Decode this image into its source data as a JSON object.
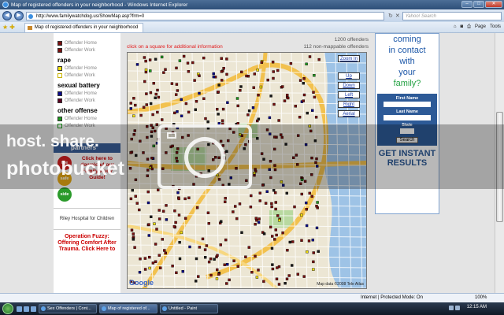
{
  "window": {
    "title": "Map of registered offenders in your neighborhood - Windows Internet Explorer",
    "url": "http://www.familywatchdog.us/ShowMap.asp?frm=0",
    "search_placeholder": "Yahoo! Search",
    "tab_label": "Map of registered offenders in your neighborhood",
    "cmd": {
      "page": "Page",
      "tools": "Tools"
    }
  },
  "legend": {
    "offender_home": "Offender Home",
    "offender_work": "Offender Work",
    "categories": [
      {
        "name": "",
        "home_color": "#7a0f0f",
        "work_color": "#7a0f0f"
      },
      {
        "name": "rape",
        "home_color": "#f4e10b",
        "work_color": "#f4e10b"
      },
      {
        "name": "sexual battery",
        "home_color": "#0a0a8c",
        "work_color": "#5a0020"
      },
      {
        "name": "other offense",
        "home_color": "#1f9a1f",
        "work_color": "#1f9a1f"
      }
    ],
    "partners": "partners",
    "traffic": [
      "the",
      "safe",
      "side"
    ],
    "family_study": "Click here to download our FamilyStudy Guide!",
    "riley": "Riley Hospital for Children",
    "fuzzy": "Operation Fuzzy: Offering Comfort After Trauma. Click Here to"
  },
  "map": {
    "hint": "click on a square for additional information",
    "total": "1200 offenders",
    "non_mappable": "112 non-mappable offenders",
    "controls": [
      "Zoom In",
      "Up",
      "Down",
      "Left",
      "Right",
      "Aerial"
    ],
    "google": "Google",
    "attribution": "Map data ©2008 Tele Atlas"
  },
  "ad": {
    "line1": "coming",
    "line2": "in contact",
    "line3": "with",
    "line4": "your",
    "line5": "family?",
    "first_name": "First Name",
    "last_name": "Last Name",
    "state": "State",
    "search_btn": "Search",
    "cta": "GET INSTANT RESULTS"
  },
  "watermark": {
    "line1": "host. share.",
    "line2": "photobucket"
  },
  "status": {
    "zone": "Internet | Protected Mode: On",
    "zoom": "100%"
  },
  "taskbar": {
    "tasks": [
      "Sex Offenders | Cont...",
      "Map of registered of...",
      "Untitled - Paint"
    ],
    "clock": "12:15 AM"
  },
  "colors": {
    "accent": "#2d5a97",
    "hint": "#e21b1b",
    "marker_home": "#7a0f0f"
  }
}
